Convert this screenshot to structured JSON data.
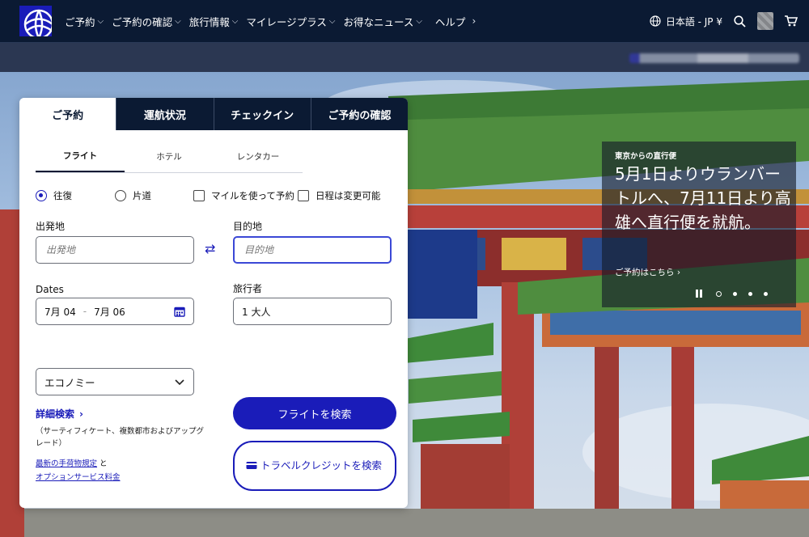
{
  "nav": {
    "items": [
      {
        "label": "ご予約",
        "chevron": "down"
      },
      {
        "label": "ご予約の確認",
        "chevron": "down"
      },
      {
        "label": "旅行情報",
        "chevron": "down"
      },
      {
        "label": "マイレージプラス",
        "chevron": "down"
      },
      {
        "label": "お得なニュース",
        "chevron": "down"
      },
      {
        "label": "ヘルプ",
        "chevron": "right"
      }
    ],
    "language": "日本語 - JP ¥",
    "icons": [
      "globe-icon",
      "search-icon",
      "avatar",
      "cart-icon"
    ]
  },
  "booking": {
    "tabs": [
      "ご予約",
      "運航状況",
      "チェックイン",
      "ご予約の確認"
    ],
    "active_tab": "ご予約",
    "sub_tabs": [
      "フライト",
      "ホテル",
      "レンタカー"
    ],
    "active_sub_tab": "フライト",
    "trip_types": [
      "往復",
      "片道"
    ],
    "selected_trip_type": "往復",
    "miles_checkbox": "マイルを使って予約",
    "flexible_checkbox": "日程は変更可能",
    "origin": {
      "label": "出発地",
      "placeholder": "出発地",
      "value": ""
    },
    "destination": {
      "label": "目的地",
      "placeholder": "目的地",
      "value": ""
    },
    "dates": {
      "label": "Dates",
      "start": "7月 04",
      "separator": "-",
      "end": "7月 06"
    },
    "travelers": {
      "label": "旅行者",
      "value": "1 大人"
    },
    "cabin": "エコノミー",
    "advanced_search": "詳細検索",
    "advanced_note": "（サーティフィケート、複数都市およびアップグレード）",
    "baggage_link": "最新の手荷物規定",
    "baggage_and": "と",
    "options_link": "オプションサービス料金",
    "search_button": "フライトを検索",
    "travel_credit_button": "トラベルクレジットを検索"
  },
  "promo": {
    "kicker": "東京からの直行便",
    "headline": "5月1日よりウランバートルへ、7月11日より高雄へ直行便を就航。",
    "cta": "ご予約はこちら ›",
    "slides": 4,
    "active_slide": 1
  },
  "colors": {
    "nav_bg": "#0b1a33",
    "brand_blue": "#1a1cb9",
    "focus_border": "#3b48d6"
  }
}
